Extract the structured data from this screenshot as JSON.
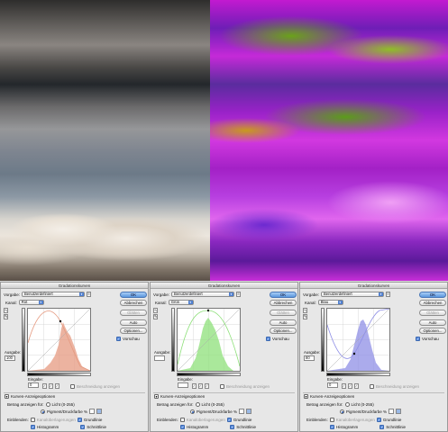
{
  "dialogs": [
    {
      "title": "Gradationskurven",
      "preset_label": "Vorgabe:",
      "preset_value": "Benutzerdefiniert",
      "channel_label": "Kanal:",
      "channel_value": "Rot",
      "ok": "OK",
      "cancel": "Abbrechen",
      "smooth": "Glätten",
      "auto": "Auto",
      "options": "Optionen...",
      "preview": "Vorschau",
      "output_label": "Ausgabe:",
      "output_value": "100",
      "input_label": "Eingabe:",
      "input_value": "0",
      "clipping": "Beschneidung anzeigen",
      "curve_options": "Kurven-Anzeigeoptionen",
      "show_amount": "Betrag anzeigen für:",
      "light": "Licht (0-255)",
      "pigment": "Pigment/Druckfarbe %",
      "show_label": "Einblenden:",
      "channel_overlays": "Kanalüberlagerungen",
      "baseline": "Grundlinie",
      "histogram": "Histogramm",
      "intersection": "Schnittlinie",
      "color": "#e59a80"
    },
    {
      "title": "Gradationskurven",
      "preset_label": "Vorgabe:",
      "preset_value": "Benutzerdefiniert",
      "channel_label": "Kanal:",
      "channel_value": "Grün",
      "ok": "OK",
      "cancel": "Abbrechen",
      "smooth": "Glätten",
      "auto": "Auto",
      "options": "Optionen...",
      "preview": "Vorschau",
      "output_label": "Ausgabe:",
      "output_value": "",
      "input_label": "Eingabe:",
      "input_value": "",
      "clipping": "Beschneidung anzeigen",
      "curve_options": "Kurven-Anzeigeoptionen",
      "show_amount": "Betrag anzeigen für:",
      "light": "Licht (0-255)",
      "pigment": "Pigment/Druckfarbe %",
      "show_label": "Einblenden:",
      "channel_overlays": "Kanalüberlagerungen",
      "baseline": "Grundlinie",
      "histogram": "Histogramm",
      "intersection": "Schnittlinie",
      "color": "#8ee07a"
    },
    {
      "title": "Gradationskurven",
      "preset_label": "Vorgabe:",
      "preset_value": "Benutzerdefiniert",
      "channel_label": "Kanal:",
      "channel_value": "Blau",
      "ok": "OK",
      "cancel": "Abbrechen",
      "smooth": "Glätten",
      "auto": "Auto",
      "options": "Optionen...",
      "preview": "Vorschau",
      "output_label": "Ausgabe:",
      "output_value": "80",
      "input_label": "Eingabe:",
      "input_value": "0",
      "clipping": "Beschneidung anzeigen",
      "curve_options": "Kurven-Anzeigeoptionen",
      "show_amount": "Betrag anzeigen für:",
      "light": "Licht (0-255)",
      "pigment": "Pigment/Druckfarbe %",
      "show_label": "Einblenden:",
      "channel_overlays": "Kanalüberlagerungen",
      "baseline": "Grundlinie",
      "histogram": "Histogramm",
      "intersection": "Schnittlinie",
      "color": "#8f8fe6"
    }
  ]
}
